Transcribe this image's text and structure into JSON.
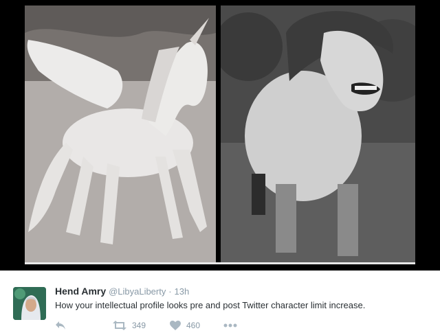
{
  "tweet": {
    "author_name": "Hend Amry",
    "handle": "@LibyaLiberty",
    "separator": "·",
    "time": "13h",
    "text": "How your intellectual profile looks pre and post Twitter character limit increase.",
    "retweet_count": "349",
    "like_count": "460"
  },
  "icons": {
    "reply": "reply-icon",
    "retweet": "retweet-icon",
    "like": "heart-icon",
    "more": "more-dots-icon"
  },
  "colors": {
    "icon_gray": "#aab8c2",
    "meta_gray": "#8899a6",
    "text": "#292f33"
  }
}
